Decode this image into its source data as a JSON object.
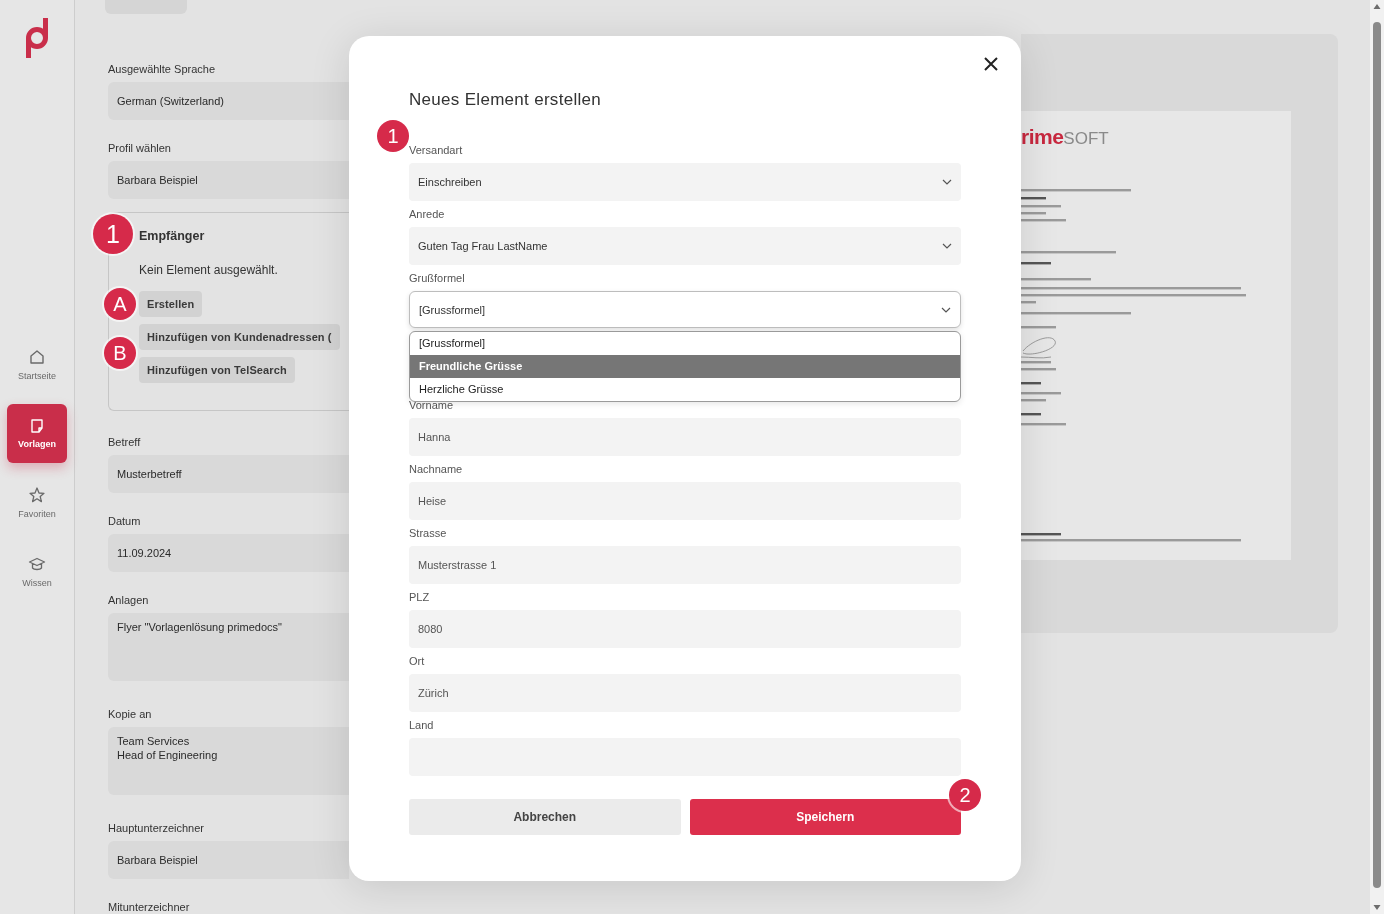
{
  "sidebar": {
    "nav": [
      {
        "label": "Startseite",
        "selected": false
      },
      {
        "label": "Vorlagen",
        "selected": true
      },
      {
        "label": "Favoriten",
        "selected": false
      },
      {
        "label": "Wissen",
        "selected": false
      }
    ]
  },
  "form": {
    "fields": [
      {
        "kind": "input",
        "label": "Ausgewählte Sprache",
        "value": "German (Switzerland)"
      },
      {
        "kind": "input",
        "label": "Profil wählen",
        "value": "Barbara Beispiel"
      },
      {
        "kind": "recipients",
        "badge": "1",
        "label": "Empfänger",
        "empty_text": "Kein Element ausgewählt.",
        "actions": [
          {
            "label": "Erstellen",
            "badge": "A"
          },
          {
            "label": "Hinzufügen von Kundenadressen (",
            "badge": "B"
          },
          {
            "label": "Hinzufügen von TelSearch"
          }
        ]
      },
      {
        "kind": "input",
        "label": "Betreff",
        "value": "Musterbetreff"
      },
      {
        "kind": "input",
        "label": "Datum",
        "value": "11.09.2024"
      },
      {
        "kind": "textarea",
        "label": "Anlagen",
        "value": "Flyer \"Vorlagenlösung primedocs\""
      },
      {
        "kind": "textarea",
        "label": "Kopie an",
        "value": "Team Services\nHead of Engineering"
      },
      {
        "kind": "input",
        "label": "Hauptunterzeichner",
        "value": "Barbara Beispiel"
      },
      {
        "kind": "label",
        "label": "Mitunterzeichner"
      }
    ]
  },
  "preview": {
    "logo": {
      "accent": "rime",
      "rest": "SOFT"
    }
  },
  "dialog": {
    "title": "Neues Element erstellen",
    "fields": [
      {
        "kind": "select",
        "label": "Versandart",
        "value": "Einschreiben",
        "open": false,
        "badge": "1"
      },
      {
        "kind": "select",
        "label": "Anrede",
        "value": "Guten Tag Frau LastName",
        "open": false
      },
      {
        "kind": "select",
        "label": "Grußformel",
        "value": "[Grussformel]",
        "open": true,
        "options": [
          {
            "label": "[Grussformel]",
            "highlighted": false
          },
          {
            "label": "Freundliche Grüsse",
            "highlighted": true
          },
          {
            "label": "Herzliche Grüsse",
            "highlighted": false
          }
        ]
      },
      {
        "kind": "input",
        "label": "Vorname",
        "value": "Hanna"
      },
      {
        "kind": "input",
        "label": "Nachname",
        "value": "Heise"
      },
      {
        "kind": "input",
        "label": "Strasse",
        "value": "Musterstrasse 1"
      },
      {
        "kind": "input",
        "label": "PLZ",
        "value": "8080"
      },
      {
        "kind": "input",
        "label": "Ort",
        "value": "Zürich"
      },
      {
        "kind": "input",
        "label": "Land"
      }
    ],
    "buttons": [
      {
        "label": "Abbrechen",
        "kind": "secondary"
      },
      {
        "label": "Speichern",
        "kind": "primary",
        "badge": "2"
      }
    ]
  }
}
